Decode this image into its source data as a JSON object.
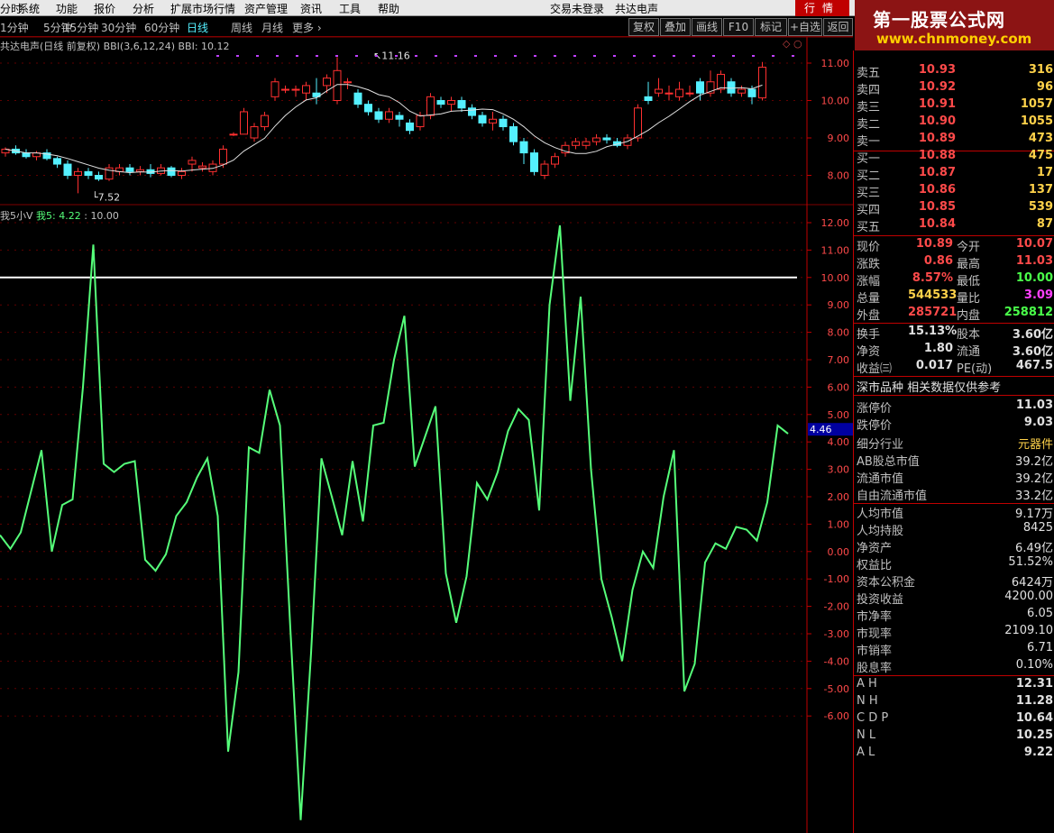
{
  "menu": {
    "items": [
      "分时",
      "系统",
      "功能",
      "报价",
      "分析",
      "扩展市场行情",
      "资产管理",
      "资讯",
      "工具",
      "帮助"
    ],
    "login_status": "交易未登录",
    "stock_name": "共达电声",
    "hq_label": "行情"
  },
  "watermark": {
    "title": "第一股票公式网",
    "url": "www.chnmoney.com"
  },
  "toolbar": {
    "periods": [
      "1分钟",
      "5分钟",
      "15分钟",
      "30分钟",
      "60分钟",
      "日线",
      "周线",
      "月线",
      "更多"
    ],
    "active_period": "日线",
    "buttons": [
      "复权",
      "叠加",
      "画线",
      "F10",
      "标记",
      "+自选",
      "返回"
    ]
  },
  "candle_panel": {
    "title": "共达电声(日线 前复权)",
    "indicator": "BBI(3,6,12,24)",
    "bbi_value": "BBI: 10.12",
    "high_mark": "11.16",
    "low_mark": "7.52",
    "y_ticks": [
      "11.00",
      "10.00",
      "9.00",
      "8.00"
    ]
  },
  "osc_panel": {
    "name": "我5小V",
    "label1": "我5: 4.22",
    "label2": "10.00",
    "y_ticks": [
      "12.00",
      "11.00",
      "10.00",
      "9.00",
      "8.00",
      "7.00",
      "6.00",
      "5.00",
      "4.00",
      "3.00",
      "2.00",
      "1.00",
      "0.00",
      "-1.00",
      "-2.00",
      "-3.00",
      "-4.00",
      "-5.00",
      "-6.00"
    ],
    "current_value_tag": "4.46",
    "threshold": 10.0,
    "values": [
      0.6,
      0.1,
      0.7,
      2.2,
      3.7,
      0.0,
      1.7,
      1.9,
      6.0,
      11.2,
      3.2,
      2.9,
      3.2,
      3.3,
      -0.3,
      -0.7,
      -0.1,
      1.3,
      1.8,
      2.7,
      3.4,
      1.3,
      -7.3,
      -4.4,
      3.8,
      3.6,
      5.9,
      4.6,
      -2.8,
      -9.8,
      -3.7,
      3.4,
      2.0,
      0.6,
      3.3,
      1.1,
      4.6,
      4.7,
      7.0,
      8.6,
      3.1,
      4.2,
      5.3,
      -0.8,
      -2.6,
      -0.9,
      2.5,
      1.9,
      2.9,
      4.4,
      5.2,
      4.8,
      1.5,
      9.0,
      11.9,
      5.5,
      9.3,
      3.0,
      -1.0,
      -2.4,
      -4.0,
      -1.4,
      0.0,
      -0.6,
      2.0,
      3.7,
      -5.1,
      -4.1,
      -0.4,
      0.3,
      0.1,
      0.9,
      0.8,
      0.4,
      1.8,
      4.6,
      4.3
    ]
  },
  "quote": {
    "sell": [
      {
        "label": "卖五",
        "price": "10.93",
        "vol": "316"
      },
      {
        "label": "卖四",
        "price": "10.92",
        "vol": "96"
      },
      {
        "label": "卖三",
        "price": "10.91",
        "vol": "1057"
      },
      {
        "label": "卖二",
        "price": "10.90",
        "vol": "1055"
      },
      {
        "label": "卖一",
        "price": "10.89",
        "vol": "473"
      }
    ],
    "buy": [
      {
        "label": "买一",
        "price": "10.88",
        "vol": "475"
      },
      {
        "label": "买二",
        "price": "10.87",
        "vol": "17"
      },
      {
        "label": "买三",
        "price": "10.86",
        "vol": "137"
      },
      {
        "label": "买四",
        "price": "10.85",
        "vol": "539"
      },
      {
        "label": "买五",
        "price": "10.84",
        "vol": "87"
      }
    ],
    "stats": [
      {
        "l1": "现价",
        "v1": "10.89",
        "c1": "red",
        "l2": "今开",
        "v2": "10.07",
        "c2": "red"
      },
      {
        "l1": "涨跌",
        "v1": "0.86",
        "c1": "red",
        "l2": "最高",
        "v2": "11.03",
        "c2": "red"
      },
      {
        "l1": "涨幅",
        "v1": "8.57%",
        "c1": "red",
        "l2": "最低",
        "v2": "10.00",
        "c2": "green"
      },
      {
        "l1": "总量",
        "v1": "544533",
        "c1": "yellow",
        "l2": "量比",
        "v2": "3.09",
        "c2": "purple"
      },
      {
        "l1": "外盘",
        "v1": "285721",
        "c1": "red",
        "l2": "内盘",
        "v2": "258812",
        "c2": "green"
      }
    ],
    "fundamentals": [
      {
        "l1": "换手",
        "v1": "15.13%",
        "c1": "white",
        "l2": "股本",
        "v2": "3.60亿",
        "c2": "white"
      },
      {
        "l1": "净资",
        "v1": "1.80",
        "c1": "white",
        "l2": "流通",
        "v2": "3.60亿",
        "c2": "white"
      },
      {
        "l1": "收益㈢",
        "v1": "0.017",
        "c1": "white",
        "l2": "PE(动)",
        "v2": "467.5",
        "c2": "white"
      }
    ],
    "section_title": "深市品种  相关数据仅供参考",
    "limits": [
      {
        "l": "涨停价",
        "v": "11.03",
        "c": "red"
      },
      {
        "l": "跌停价",
        "v": "9.03",
        "c": "green"
      }
    ],
    "info": [
      {
        "l": "细分行业",
        "v": "元器件"
      },
      {
        "l": "AB股总市值",
        "v": "39.2亿"
      },
      {
        "l": "流通市值",
        "v": "39.2亿"
      },
      {
        "l": "自由流通市值",
        "v": "33.2亿"
      }
    ],
    "info2": [
      {
        "l": "人均市值",
        "v": "9.17万"
      },
      {
        "l": "人均持股",
        "v": "8425"
      },
      {
        "l": "净资产",
        "v": "6.49亿"
      },
      {
        "l": "权益比",
        "v": "51.52%"
      },
      {
        "l": "资本公积金",
        "v": "6424万"
      },
      {
        "l": "投资收益",
        "v": "4200.00"
      },
      {
        "l": "市净率",
        "v": "6.05"
      },
      {
        "l": "市现率",
        "v": "2109.10"
      },
      {
        "l": "市销率",
        "v": "6.71"
      },
      {
        "l": "股息率",
        "v": "0.10%"
      }
    ],
    "indices": [
      {
        "l": "A H",
        "v": "12.31"
      },
      {
        "l": "N H",
        "v": "11.28"
      },
      {
        "l": "C D P",
        "v": "10.64"
      },
      {
        "l": "N L",
        "v": "10.25"
      },
      {
        "l": "A L",
        "v": "9.22"
      }
    ]
  },
  "colors": {
    "up": "#ff3030",
    "down": "#54f0ff",
    "osc_line": "#56ff7a",
    "bbi_line": "#e0e0e0",
    "border": "#c00000"
  }
}
